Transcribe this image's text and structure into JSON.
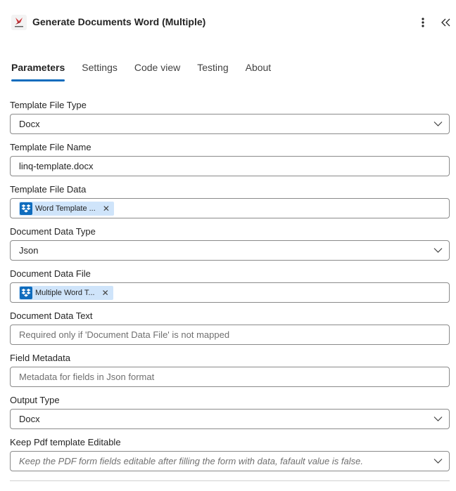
{
  "header": {
    "title": "Generate Documents Word (Multiple)",
    "icons": {
      "app": "app-logo-icon",
      "more": "more-vertical-icon",
      "collapse": "double-chevron-left-icon"
    }
  },
  "tabs": [
    {
      "label": "Parameters",
      "active": true
    },
    {
      "label": "Settings",
      "active": false
    },
    {
      "label": "Code view",
      "active": false
    },
    {
      "label": "Testing",
      "active": false
    },
    {
      "label": "About",
      "active": false
    }
  ],
  "fields": {
    "template_file_type": {
      "label": "Template File Type",
      "value": "Docx"
    },
    "template_file_name": {
      "label": "Template File Name",
      "value": "linq-template.docx"
    },
    "template_file_data": {
      "label": "Template File Data",
      "token": "Word Template ..."
    },
    "document_data_type": {
      "label": "Document Data Type",
      "value": "Json"
    },
    "document_data_file": {
      "label": "Document Data File",
      "token": "Multiple Word T..."
    },
    "document_data_text": {
      "label": "Document Data Text",
      "placeholder": "Required only if 'Document Data File' is not mapped"
    },
    "field_metadata": {
      "label": "Field Metadata",
      "placeholder": "Metadata for fields in Json format"
    },
    "output_type": {
      "label": "Output Type",
      "value": "Docx"
    },
    "keep_pdf_editable": {
      "label": "Keep Pdf template Editable",
      "placeholder": "Keep the PDF form fields editable after filling the form with data, fafault value is false."
    }
  },
  "colors": {
    "accent": "#0f6cbd",
    "token_bg": "#cfe4fa",
    "border": "#8a8a8a"
  }
}
